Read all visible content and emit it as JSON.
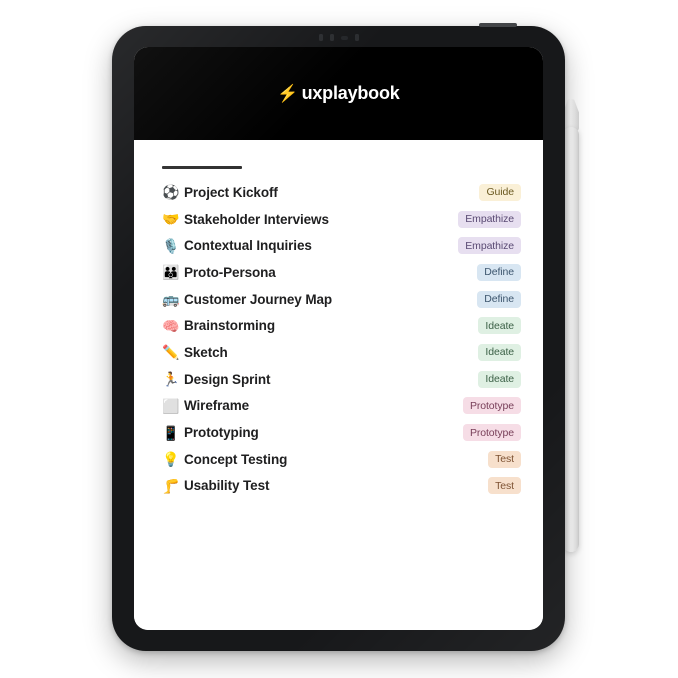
{
  "device": {
    "type": "tablet",
    "body_color": "#17181a",
    "screen_bg": "#ffffff",
    "stylus": "white-stylus-pen"
  },
  "header": {
    "background": "#000000",
    "logo_icon": "lightning-bolt-icon",
    "logo_glyph": "⚡",
    "brand_name": "uxplaybook",
    "brand_color": "#ffffff",
    "accent_color": "#f5c518"
  },
  "badge_colors": {
    "Guide": "#faf0d7",
    "Empathize": "#e7dff0",
    "Define": "#d8e6f2",
    "Ideate": "#dff0e3",
    "Prototype": "#f6dde6",
    "Test": "#f7e0cc"
  },
  "task_list": {
    "items": [
      {
        "emoji": "⚽",
        "icon_name": "soccer-ball-icon",
        "label": "Project Kickoff",
        "badge": "Guide"
      },
      {
        "emoji": "🤝",
        "icon_name": "handshake-icon",
        "label": "Stakeholder Interviews",
        "badge": "Empathize"
      },
      {
        "emoji": "🎙️",
        "icon_name": "microphone-icon",
        "label": "Contextual Inquiries",
        "badge": "Empathize"
      },
      {
        "emoji": "👪",
        "icon_name": "family-icon",
        "label": "Proto-Persona",
        "badge": "Define"
      },
      {
        "emoji": "🚌",
        "icon_name": "bus-icon",
        "label": "Customer Journey Map",
        "badge": "Define"
      },
      {
        "emoji": "🧠",
        "icon_name": "brain-icon",
        "label": "Brainstorming",
        "badge": "Ideate"
      },
      {
        "emoji": "✏️",
        "icon_name": "pencil-icon",
        "label": "Sketch",
        "badge": "Ideate"
      },
      {
        "emoji": "🏃",
        "icon_name": "runner-icon",
        "label": "Design Sprint",
        "badge": "Ideate"
      },
      {
        "emoji": "⬜",
        "icon_name": "white-square-icon",
        "label": "Wireframe",
        "badge": "Prototype"
      },
      {
        "emoji": "📱",
        "icon_name": "mobile-phone-icon",
        "label": "Prototyping",
        "badge": "Prototype"
      },
      {
        "emoji": "💡",
        "icon_name": "lightbulb-icon",
        "label": "Concept Testing",
        "badge": "Test"
      },
      {
        "emoji": "🦵",
        "icon_name": "leg-icon",
        "label": "Usability Test",
        "badge": "Test"
      }
    ]
  }
}
